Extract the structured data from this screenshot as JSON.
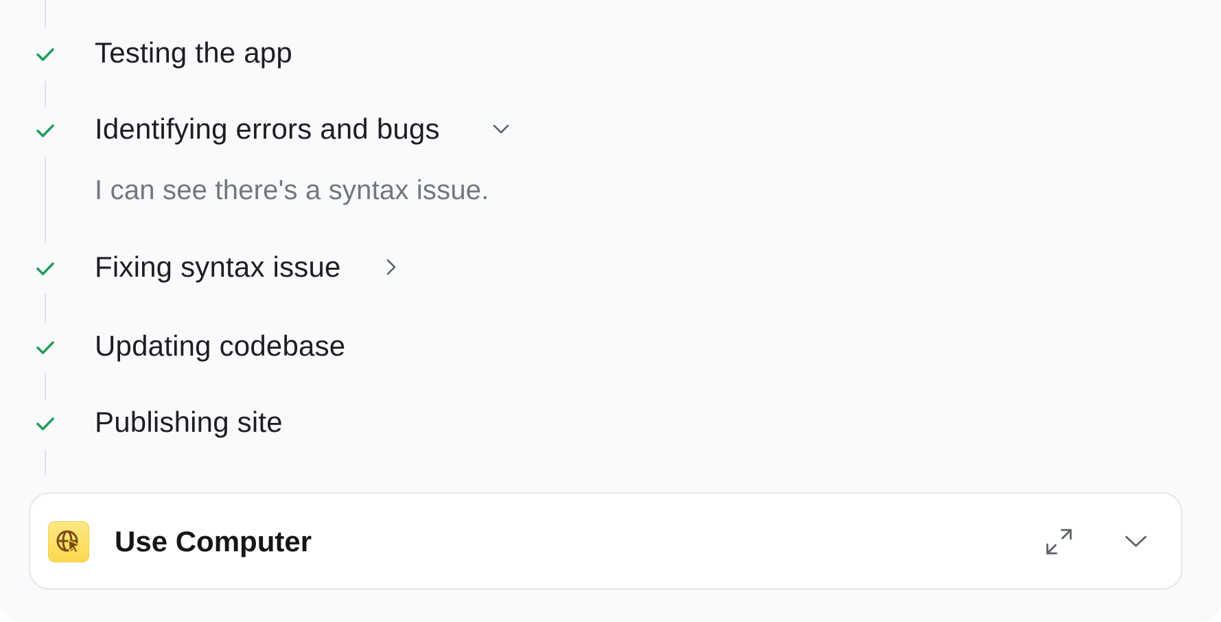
{
  "steps": [
    {
      "label": "Testing the app",
      "status": "done",
      "toggle": "none"
    },
    {
      "label": "Identifying errors and bugs",
      "status": "done",
      "toggle": "chevron-down-icon"
    },
    {
      "label": "Fixing syntax issue",
      "status": "done",
      "toggle": "chevron-right-icon"
    },
    {
      "label": "Updating codebase",
      "status": "done",
      "toggle": "none"
    },
    {
      "label": "Publishing site",
      "status": "done",
      "toggle": "none"
    }
  ],
  "expanded_detail": {
    "text": "I can see there's a syntax issue."
  },
  "tool_card": {
    "title": "Use Computer",
    "icon": "globe-cursor-icon",
    "actions": [
      "expand-icon",
      "chevron-down-icon"
    ]
  },
  "colors": {
    "check": "#1f9d5a",
    "text": "#1c1e21",
    "muted_text": "#717680",
    "rail": "#dfe1e6",
    "icon_bg": "#fcd94e"
  }
}
